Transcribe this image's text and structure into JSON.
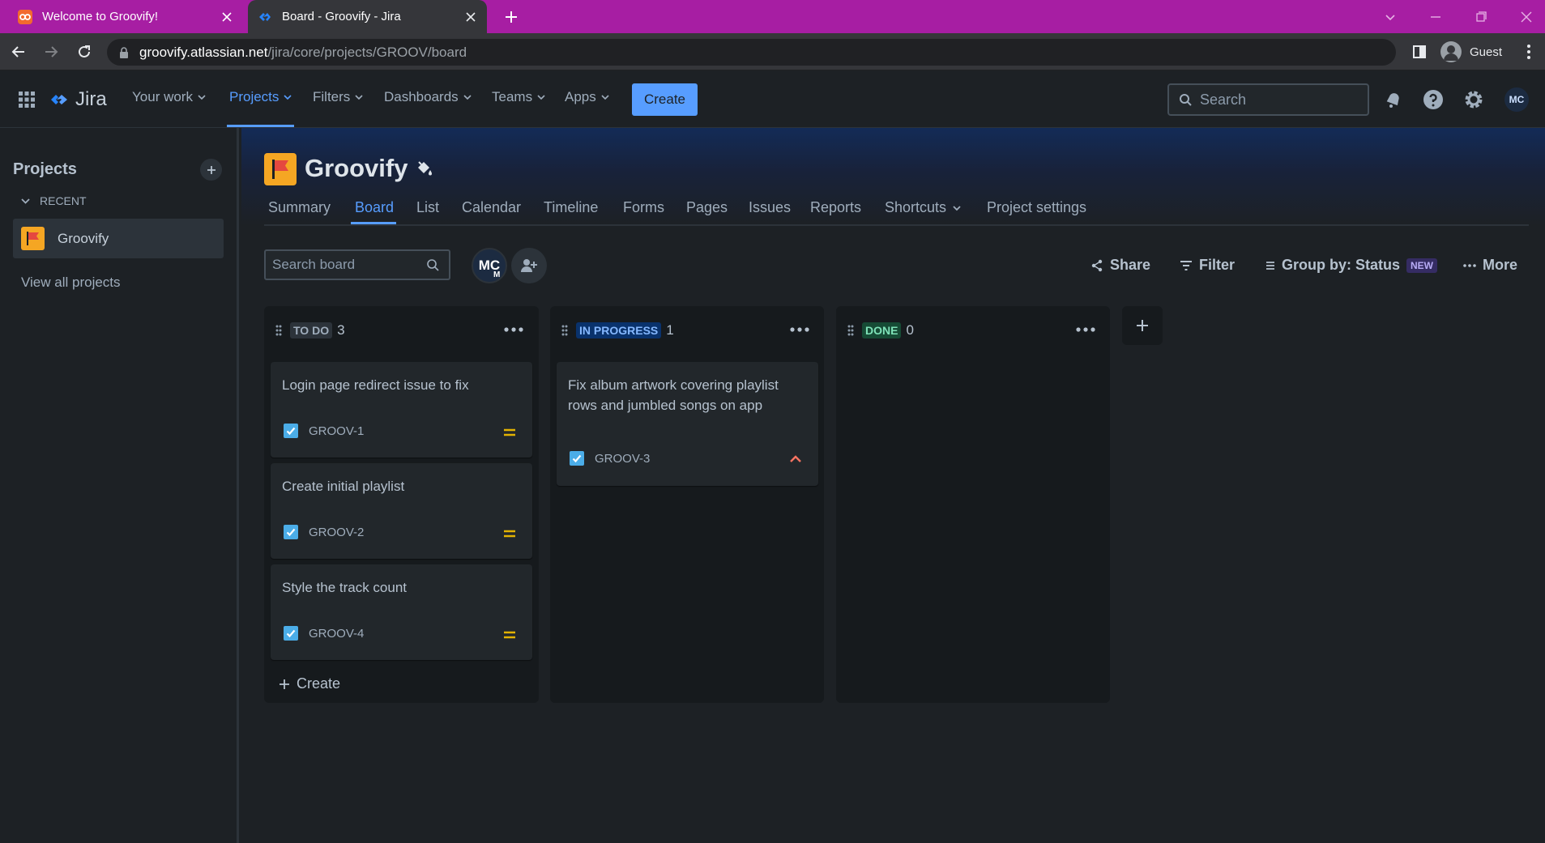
{
  "browser": {
    "tabs": [
      {
        "title": "Welcome to Groovify!",
        "icon": "groovify-favicon",
        "active": false
      },
      {
        "title": "Board - Groovify - Jira",
        "icon": "jira-favicon",
        "active": true
      }
    ],
    "url_host": "groovify.atlassian.net",
    "url_path": "/jira/core/projects/GROOV/board",
    "profile_label": "Guest",
    "colors": {
      "tabstrip": "#a71ea3",
      "toolbar": "#35363a"
    }
  },
  "jira_nav": {
    "product": "Jira",
    "items": [
      {
        "label": "Your work"
      },
      {
        "label": "Projects"
      },
      {
        "label": "Filters"
      },
      {
        "label": "Dashboards"
      },
      {
        "label": "Teams"
      },
      {
        "label": "Apps"
      }
    ],
    "create_label": "Create",
    "search_placeholder": "Search",
    "profile_initials": "MC",
    "accent": "#579dff"
  },
  "sidebar": {
    "title": "Projects",
    "section": "RECENT",
    "project": "Groovify",
    "view_all": "View all projects"
  },
  "project": {
    "name": "Groovify",
    "tabs": [
      {
        "label": "Summary"
      },
      {
        "label": "Board"
      },
      {
        "label": "List"
      },
      {
        "label": "Calendar"
      },
      {
        "label": "Timeline"
      },
      {
        "label": "Forms"
      },
      {
        "label": "Pages"
      },
      {
        "label": "Issues"
      },
      {
        "label": "Reports"
      },
      {
        "label": "Shortcuts"
      },
      {
        "label": "Project settings"
      }
    ],
    "active_tab": "Board"
  },
  "board": {
    "search_placeholder": "Search board",
    "avatar_initials": "MC",
    "avatar_badge": "M",
    "toolbar": {
      "share": "Share",
      "filter": "Filter",
      "group_by": "Group by: Status",
      "new_badge": "NEW",
      "more": "More"
    },
    "columns": [
      {
        "name": "TO DO",
        "count": "3",
        "lozenge_bg": "#2c333a",
        "lozenge_fg": "#9fadbc",
        "cards": [
          {
            "title": "Login page redirect issue to fix",
            "key": "GROOV-1",
            "priority": "medium"
          },
          {
            "title": "Create initial playlist",
            "key": "GROOV-2",
            "priority": "medium"
          },
          {
            "title": "Style the track count",
            "key": "GROOV-4",
            "priority": "medium"
          }
        ],
        "create_label": "Create"
      },
      {
        "name": "IN PROGRESS",
        "count": "1",
        "lozenge_bg": "#09326c",
        "lozenge_fg": "#85b8ff",
        "cards": [
          {
            "title": "Fix album artwork covering playlist rows and jumbled songs on app",
            "key": "GROOV-3",
            "priority": "high"
          }
        ]
      },
      {
        "name": "DONE",
        "count": "0",
        "lozenge_bg": "#164b35",
        "lozenge_fg": "#7ee2b8",
        "cards": []
      }
    ],
    "priority_colors": {
      "medium": "#e2b203",
      "high": "#f87462"
    }
  }
}
